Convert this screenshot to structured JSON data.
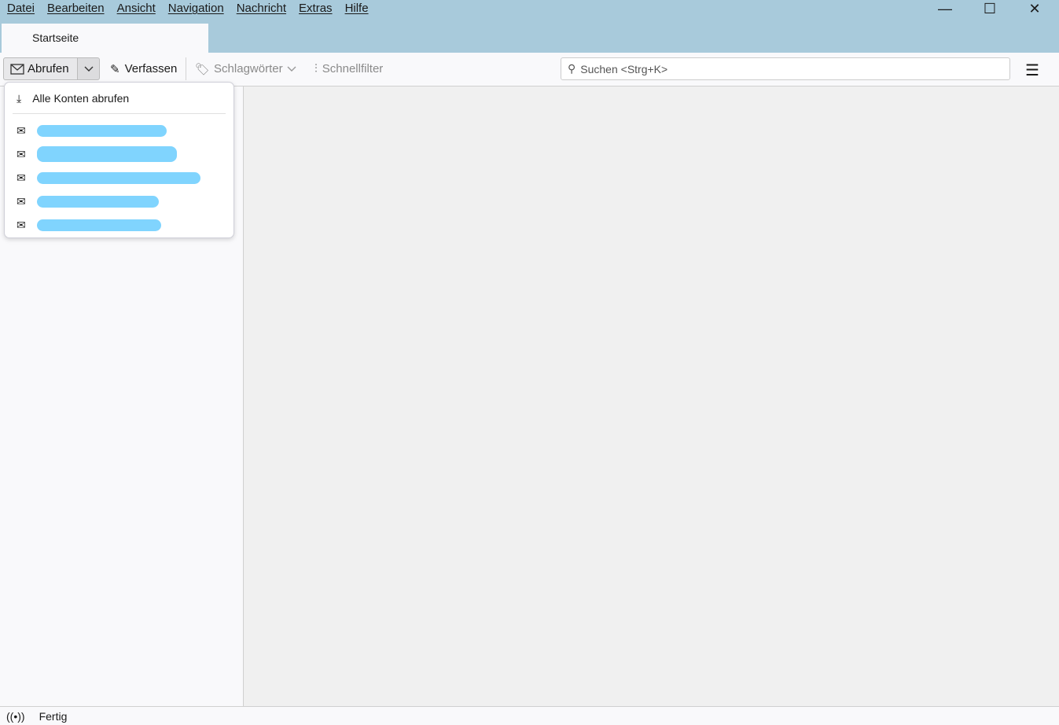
{
  "menu": [
    "Datei",
    "Bearbeiten",
    "Ansicht",
    "Navigation",
    "Nachricht",
    "Extras",
    "Hilfe"
  ],
  "window": {
    "minimize": "—",
    "maximize": "☐",
    "close": "✕"
  },
  "tab": {
    "label": "Startseite"
  },
  "toolbar": {
    "get_messages": "Abrufen",
    "compose": "Verfassen",
    "tags": "Schlagwörter",
    "quick_filter": "Schnellfilter",
    "search_placeholder": "Suchen <Strg+K>"
  },
  "popup": {
    "get_all": "Alle Konten abrufen",
    "accounts_count": 5
  },
  "status": {
    "text": "Fertig"
  },
  "colors": {
    "titlebar": "#a8cadb",
    "redaction": "#80d4fe"
  }
}
